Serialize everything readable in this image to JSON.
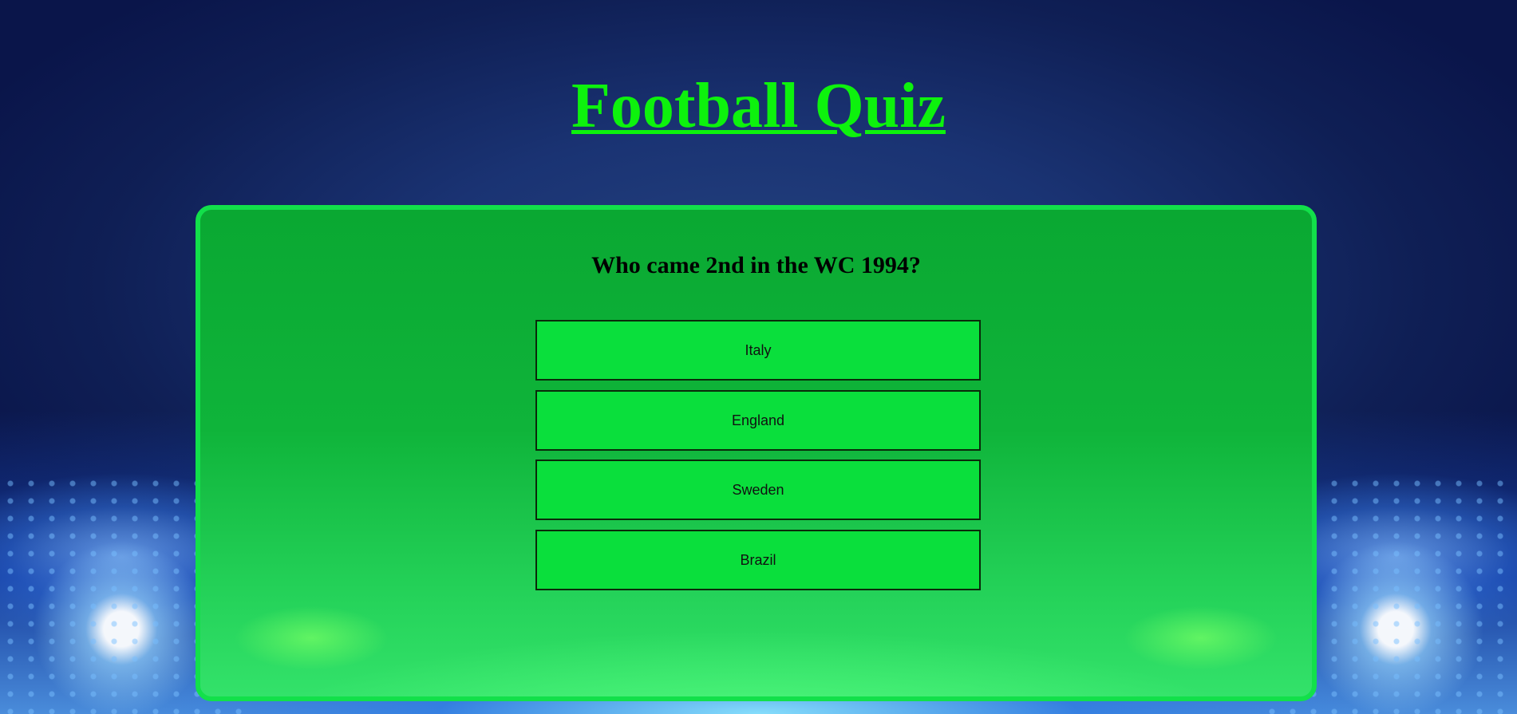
{
  "page": {
    "title": "Football Quiz"
  },
  "quiz": {
    "question": "Who came 2nd in the WC 1994?",
    "answers": [
      {
        "label": "Italy"
      },
      {
        "label": "England"
      },
      {
        "label": "Sweden"
      },
      {
        "label": "Brazil"
      }
    ]
  },
  "colors": {
    "title": "#0df20d",
    "card_border": "#12e04a",
    "answer_bg": "#0adf3c",
    "background": "#1a3373"
  }
}
